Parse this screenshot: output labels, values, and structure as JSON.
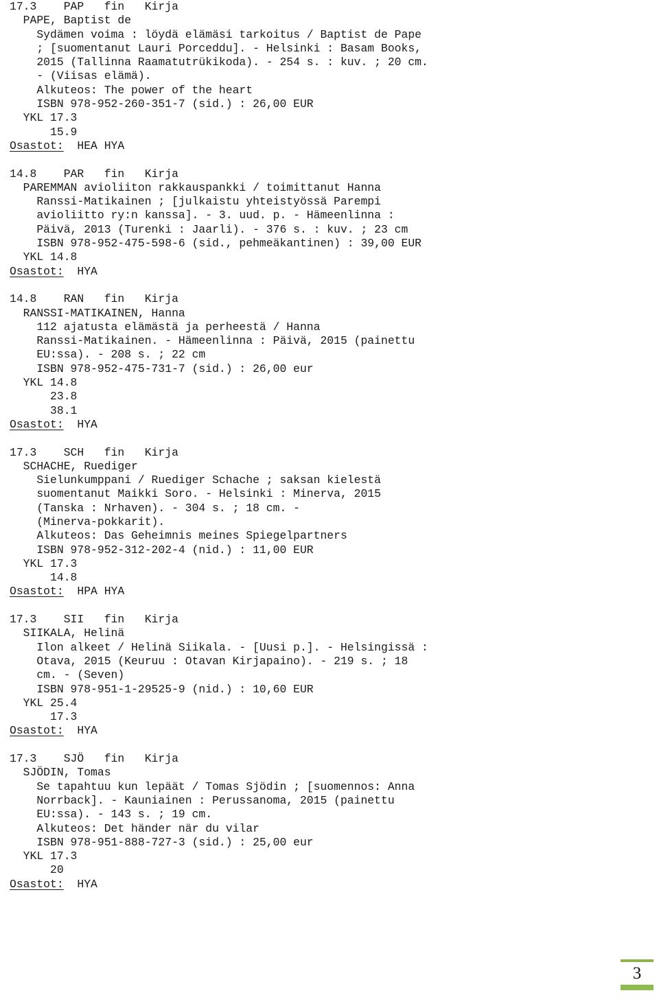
{
  "document": {
    "type": "library-catalog-listing",
    "language": "fi",
    "page_number": "3"
  },
  "records": [
    {
      "header": "17.3    PAP   fin   Kirja",
      "lines": [
        "  PAPE, Baptist de",
        "    Sydämen voima : löydä elämäsi tarkoitus / Baptist de Pape",
        "    ; [suomentanut Lauri Porceddu]. - Helsinki : Basam Books,",
        "    2015 (Tallinna Raamatutrükikoda). - 254 s. : kuv. ; 20 cm.",
        "    - (Viisas elämä).",
        "    Alkuteos: The power of the heart",
        "    ISBN 978-952-260-351-7 (sid.) : 26,00 EUR",
        "  YKL 17.3",
        "      15.9"
      ],
      "osastot_label": "Osastot:",
      "osastot_value": "  HEA HYA"
    },
    {
      "header": "14.8    PAR   fin   Kirja",
      "lines": [
        "  PAREMMAN avioliiton rakkauspankki / toimittanut Hanna",
        "    Ranssi-Matikainen ; [julkaistu yhteistyössä Parempi",
        "    avioliitto ry:n kanssa]. - 3. uud. p. - Hämeenlinna :",
        "    Päivä, 2013 (Turenki : Jaarli). - 376 s. : kuv. ; 23 cm",
        "    ISBN 978-952-475-598-6 (sid., pehmeäkantinen) : 39,00 EUR",
        "  YKL 14.8"
      ],
      "osastot_label": "Osastot:",
      "osastot_value": "  HYA"
    },
    {
      "header": "14.8    RAN   fin   Kirja",
      "lines": [
        "  RANSSI-MATIKAINEN, Hanna",
        "    112 ajatusta elämästä ja perheestä / Hanna",
        "    Ranssi-Matikainen. - Hämeenlinna : Päivä, 2015 (painettu",
        "    EU:ssa). - 208 s. ; 22 cm",
        "    ISBN 978-952-475-731-7 (sid.) : 26,00 eur",
        "  YKL 14.8",
        "      23.8",
        "      38.1"
      ],
      "osastot_label": "Osastot:",
      "osastot_value": "  HYA"
    },
    {
      "header": "17.3    SCH   fin   Kirja",
      "lines": [
        "  SCHACHE, Ruediger",
        "    Sielunkumppani / Ruediger Schache ; saksan kielestä",
        "    suomentanut Maikki Soro. - Helsinki : Minerva, 2015",
        "    (Tanska : Nrhaven). - 304 s. ; 18 cm. -",
        "    (Minerva-pokkarit).",
        "    Alkuteos: Das Geheimnis meines Spiegelpartners",
        "    ISBN 978-952-312-202-4 (nid.) : 11,00 EUR",
        "  YKL 17.3",
        "      14.8"
      ],
      "osastot_label": "Osastot:",
      "osastot_value": "  HPA HYA"
    },
    {
      "header": "17.3    SII   fin   Kirja",
      "lines": [
        "  SIIKALA, Helinä",
        "    Ilon alkeet / Helinä Siikala. - [Uusi p.]. - Helsingissä :",
        "    Otava, 2015 (Keuruu : Otavan Kirjapaino). - 219 s. ; 18",
        "    cm. - (Seven)",
        "    ISBN 978-951-1-29525-9 (nid.) : 10,60 EUR",
        "  YKL 25.4",
        "      17.3"
      ],
      "osastot_label": "Osastot:",
      "osastot_value": "  HYA"
    },
    {
      "header": "17.3    SJÖ   fin   Kirja",
      "lines": [
        "  SJÖDIN, Tomas",
        "    Se tapahtuu kun lepäät / Tomas Sjödin ; [suomennos: Anna",
        "    Norrback]. - Kauniainen : Perussanoma, 2015 (painettu",
        "    EU:ssa). - 143 s. ; 19 cm.",
        "    Alkuteos: Det händer när du vilar",
        "    ISBN 978-951-888-727-3 (sid.) : 25,00 eur",
        "  YKL 17.3",
        "      20"
      ],
      "osastot_label": "Osastot:",
      "osastot_value": "  HYA"
    }
  ],
  "colors": {
    "accent_green": "#8dbb4e",
    "text": "#1a1a1a"
  }
}
